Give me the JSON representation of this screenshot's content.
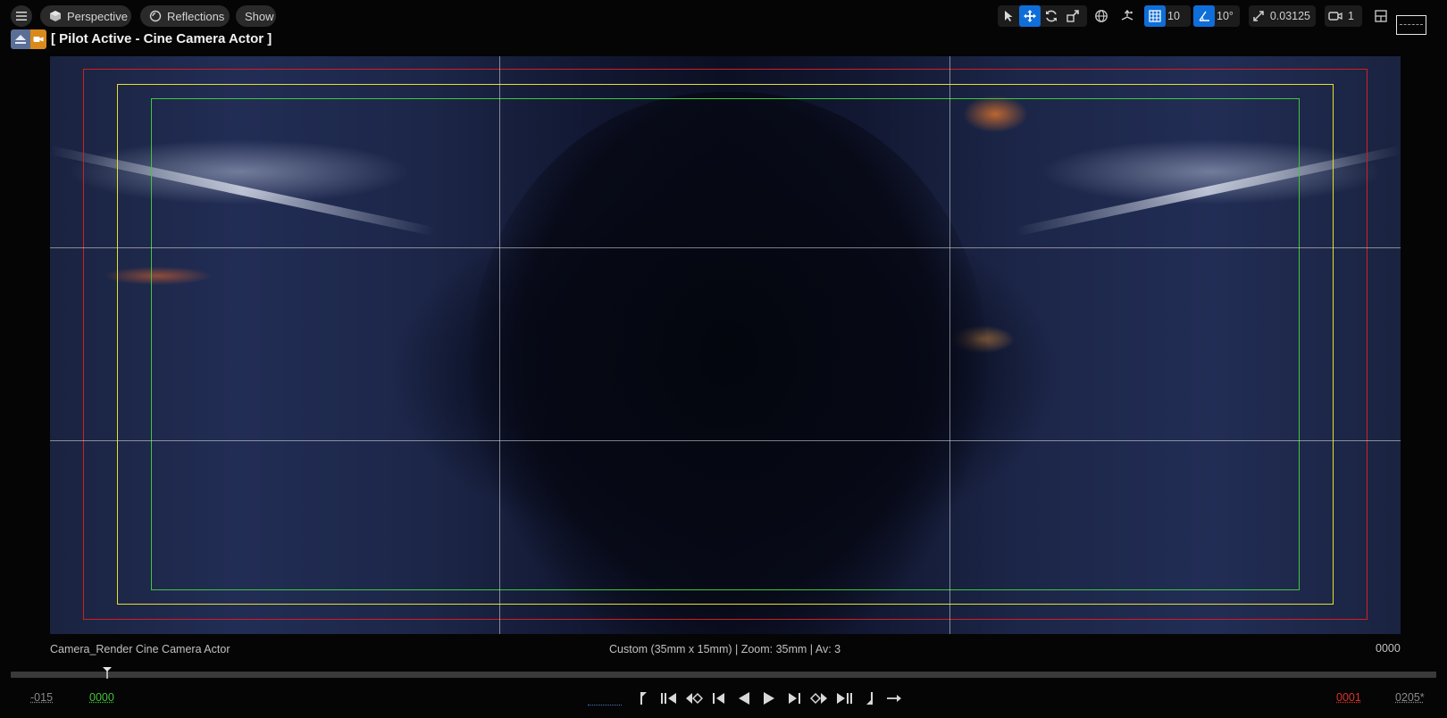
{
  "toolbar": {
    "perspective_label": "Perspective",
    "reflections_label": "Reflections",
    "show_label": "Show",
    "grid_snap_value": "10",
    "rotation_snap_value": "10°",
    "scale_snap_value": "0.03125",
    "camera_speed_value": "1"
  },
  "pilot": {
    "title": "[ Pilot Active - Cine Camera Actor ]"
  },
  "info": {
    "camera_name": "Camera_Render  Cine Camera Actor",
    "lens_info": "Custom (35mm x 15mm) | Zoom: 35mm | Av: 3",
    "frame_number": "0000"
  },
  "timeline": {
    "start_frame": "-015",
    "current_frame": "0000",
    "out_frame": "0001",
    "end_frame": "0205*"
  },
  "colors": {
    "accent": "#0f6ed8",
    "safe_frame_outer": "#d21f1f",
    "safe_frame_action": "#e6e02a",
    "safe_frame_title": "#3fc83a",
    "current_frame_color": "#44c23a",
    "out_frame_color": "#d8342b"
  },
  "icons": {
    "menu": "hamburger-icon",
    "perspective": "cube-icon",
    "reflections": "reflections-icon",
    "select": "select-arrow-icon",
    "translate": "translate-icon",
    "rotate": "rotate-icon",
    "scale": "scale-icon",
    "world": "globe-icon",
    "surface": "surface-snap-icon",
    "grid": "grid-snap-icon",
    "angle": "angle-snap-icon",
    "scale_snap": "scale-snap-icon",
    "camera": "camera-speed-icon",
    "layout": "viewport-layout-icon"
  }
}
